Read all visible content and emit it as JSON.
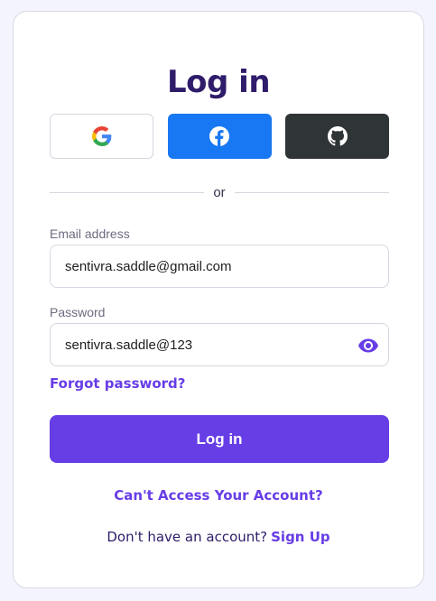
{
  "title": "Log in",
  "social": {
    "google_icon": "google-logo",
    "facebook_icon": "facebook-logo",
    "github_icon": "github-logo"
  },
  "divider_text": "or",
  "email": {
    "label": "Email address",
    "value": "sentivra.saddle@gmail.com"
  },
  "password": {
    "label": "Password",
    "value": "sentivra.saddle@123",
    "toggle_icon": "eye-icon"
  },
  "forgot_password": "Forgot password?",
  "submit_label": "Log in",
  "cant_access": "Can't Access Your Account?",
  "signup": {
    "prompt": "Don't have an account?",
    "link": "Sign Up"
  },
  "colors": {
    "brand": "#673de6",
    "title": "#2f1c6a",
    "facebook": "#1877f2",
    "github": "#2f3437"
  }
}
